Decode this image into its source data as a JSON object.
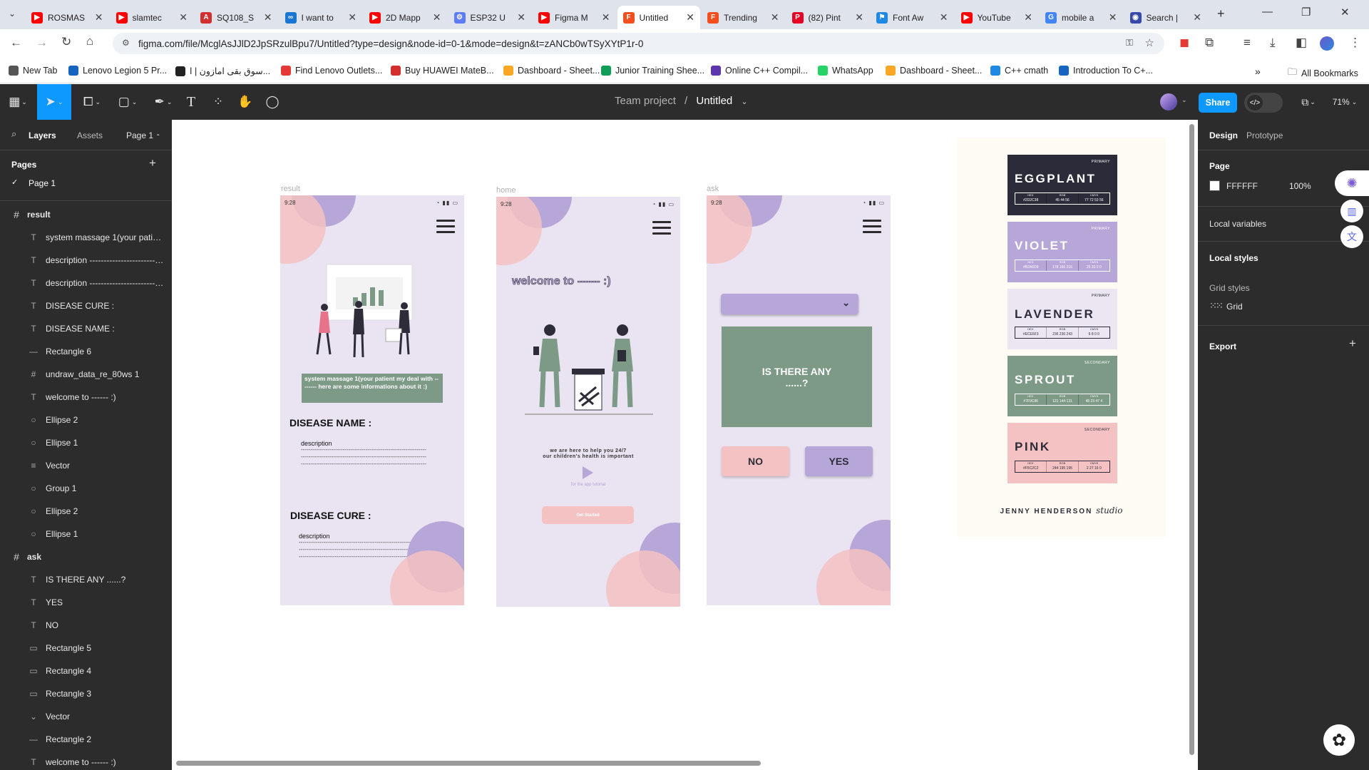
{
  "browser": {
    "tabs": [
      {
        "label": "ROSMAS",
        "color": "#ff0000",
        "glyph": "▶"
      },
      {
        "label": "slamtec",
        "color": "#ff0000",
        "glyph": "▶"
      },
      {
        "label": "SQ108_S",
        "color": "#d32f2f",
        "glyph": "A"
      },
      {
        "label": "I want to",
        "color": "#1976d2",
        "glyph": "∞"
      },
      {
        "label": "2D Mapp",
        "color": "#ff0000",
        "glyph": "▶"
      },
      {
        "label": "ESP32 U",
        "color": "#5c7cfa",
        "glyph": "⚙"
      },
      {
        "label": "Figma M",
        "color": "#ff0000",
        "glyph": "▶"
      },
      {
        "label": "Untitled",
        "color": "#f24e1e",
        "glyph": "F"
      },
      {
        "label": "Trending",
        "color": "#f24e1e",
        "glyph": "F"
      },
      {
        "label": "(82) Pint",
        "color": "#e60023",
        "glyph": "P"
      },
      {
        "label": "Font Aw",
        "color": "#1e88e5",
        "glyph": "⚑"
      },
      {
        "label": "YouTube",
        "color": "#ff0000",
        "glyph": "▶"
      },
      {
        "label": "mobile a",
        "color": "#4285f4",
        "glyph": "G"
      },
      {
        "label": "Search |",
        "color": "#3949ab",
        "glyph": "◉"
      }
    ],
    "url": "figma.com/file/McglAsJJlD2JpSRzulBpu7/Untitled?type=design&node-id=0-1&mode=design&t=zANCb0wTSyXYtP1r-0",
    "bookmarks": [
      {
        "label": "New Tab",
        "color": "#555"
      },
      {
        "label": "Lenovo Legion 5 Pr...",
        "color": "#1565c0"
      },
      {
        "label": "سوق بقى امازون | ا...",
        "color": "#222"
      },
      {
        "label": "Find Lenovo Outlets...",
        "color": "#e53935"
      },
      {
        "label": "Buy HUAWEI MateB...",
        "color": "#d32f2f"
      },
      {
        "label": "Dashboard - Sheet...",
        "color": "#f9a825"
      },
      {
        "label": "Junior Training Shee...",
        "color": "#0f9d58"
      },
      {
        "label": "Online C++ Compil...",
        "color": "#5e35b1"
      },
      {
        "label": "WhatsApp",
        "color": "#25d366"
      },
      {
        "label": "Dashboard - Sheet...",
        "color": "#f9a825"
      },
      {
        "label": "C++ cmath",
        "color": "#1e88e5"
      },
      {
        "label": "Introduction To C+...",
        "color": "#1565c0"
      }
    ],
    "all_bookmarks": "All Bookmarks"
  },
  "toolbar": {
    "team": "Team project",
    "separator": "/",
    "file": "Untitled",
    "share": "Share",
    "zoom": "71%"
  },
  "left_panel": {
    "tabs": {
      "layers": "Layers",
      "assets": "Assets",
      "page": "Page 1"
    },
    "pages_title": "Pages",
    "page_item": "Page 1",
    "layers": [
      {
        "name": "result",
        "kind": "frame"
      },
      {
        "name": "system massage 1(your patient my deal with -------- here are some informations about it :)",
        "kind": "text"
      },
      {
        "name": "description -------------------------------------------------------",
        "kind": "text"
      },
      {
        "name": "description -------------------------------------------------------",
        "kind": "text"
      },
      {
        "name": "DISEASE CURE :",
        "kind": "text"
      },
      {
        "name": "DISEASE NAME :",
        "kind": "text"
      },
      {
        "name": "Rectangle 6",
        "kind": "line"
      },
      {
        "name": "undraw_data_re_80ws 1",
        "kind": "frame-small"
      },
      {
        "name": "welcome to ------ :)",
        "kind": "text"
      },
      {
        "name": "Ellipse 2",
        "kind": "ellipse"
      },
      {
        "name": "Ellipse 1",
        "kind": "ellipse"
      },
      {
        "name": "Vector",
        "kind": "vector-lines"
      },
      {
        "name": "Group 1",
        "kind": "ellipse"
      },
      {
        "name": "Ellipse 2",
        "kind": "ellipse"
      },
      {
        "name": "Ellipse 1",
        "kind": "ellipse"
      },
      {
        "name": "ask",
        "kind": "frame"
      },
      {
        "name": "IS THERE ANY ......?",
        "kind": "text"
      },
      {
        "name": "YES",
        "kind": "text"
      },
      {
        "name": "NO",
        "kind": "text"
      },
      {
        "name": "Rectangle 5",
        "kind": "rect"
      },
      {
        "name": "Rectangle 4",
        "kind": "rect"
      },
      {
        "name": "Rectangle 3",
        "kind": "rect"
      },
      {
        "name": "Vector",
        "kind": "vector"
      },
      {
        "name": "Rectangle 2",
        "kind": "line"
      },
      {
        "name": "welcome to ------ :)",
        "kind": "text"
      }
    ]
  },
  "canvas": {
    "result": {
      "label": "result",
      "time": "9:28",
      "message": "system massage 1(your patient my deal with -------- here are some informations about it :)",
      "disease_name": "DISEASE NAME :",
      "disease_cure": "DISEASE CURE :",
      "description": "description",
      "dashes": "------------------------------------------------------------------"
    },
    "home": {
      "label": "home",
      "time": "9:28",
      "welcome": "welcome to ------ :)",
      "tagline1": "we are here to help you 24/7",
      "tagline2": "our children's health is important",
      "tutorial": "for the app tutorial",
      "cta": "Get Started"
    },
    "ask": {
      "label": "ask",
      "time": "9:28",
      "question": "IS THERE ANY ......?",
      "no": "NO",
      "yes": "YES"
    },
    "palette": {
      "swatches": [
        {
          "name": "EGGPLANT",
          "tag": "PRIMARY",
          "bg": "#2b2b39",
          "fg": "#ffffff",
          "hex": "#2D2C38",
          "rgb": "45 44 56",
          "cmyk": "77 72 53 56"
        },
        {
          "name": "VIOLET",
          "tag": "PRIMARY",
          "bg": "#b7a6d8",
          "fg": "#ffffff",
          "hex": "#B2A6D9",
          "rgb": "178 166 216",
          "cmyk": "25 33 0 0"
        },
        {
          "name": "LAVENDER",
          "tag": "PRIMARY",
          "bg": "#ece6f3",
          "fg": "#2d2c38",
          "hex": "#ECE6F3",
          "rgb": "236 230 243",
          "cmyk": "6 8 0 0"
        },
        {
          "name": "SPROUT",
          "tag": "SECONDARY",
          "bg": "#7d9a86",
          "fg": "#ffffff",
          "hex": "#7F9C86",
          "rgb": "121 144 131",
          "cmyk": "48 23 47 4"
        },
        {
          "name": "PINK",
          "tag": "SECONDARY",
          "bg": "#f4c2c2",
          "fg": "#2d2c38",
          "hex": "#F5C2C2",
          "rgb": "244 195 195",
          "cmyk": "2 27 16 0"
        }
      ],
      "table_heads": [
        "HEX",
        "RGB",
        "CMYK"
      ],
      "brand": "JENNY HENDERSON",
      "brand_script": "studio"
    }
  },
  "right_panel": {
    "tabs": {
      "design": "Design",
      "prototype": "Prototype"
    },
    "page_title": "Page",
    "page_color": "FFFFFF",
    "page_opacity": "100%",
    "local_variables": "Local variables",
    "local_styles": "Local styles",
    "grid_styles": "Grid styles",
    "grid": "Grid",
    "export": "Export"
  },
  "colors": {
    "figma_dark": "#2c2c2c",
    "accent": "#0d99ff",
    "frame_bg": "#e9e3f2",
    "violet": "#b7a6d8",
    "pink": "#f4c2c2",
    "sprout": "#7d9a86"
  }
}
